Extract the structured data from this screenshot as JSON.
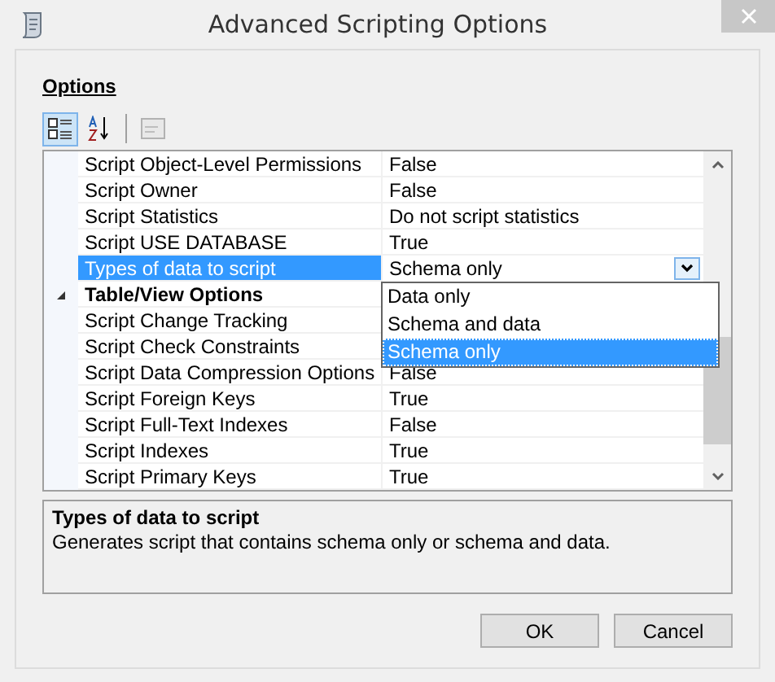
{
  "window": {
    "title": "Advanced Scripting Options"
  },
  "section_label": "Options",
  "toolbar": [
    {
      "kind": "categorized",
      "selected": true
    },
    {
      "kind": "alphabetical",
      "selected": false
    },
    {
      "kind": "pages",
      "selected": false,
      "disabled": true
    }
  ],
  "rows": [
    {
      "kind": "property",
      "name": "Script Object-Level Permissions",
      "value": "False",
      "selected": false
    },
    {
      "kind": "property",
      "name": "Script Owner",
      "value": "False",
      "selected": false
    },
    {
      "kind": "property",
      "name": "Script Statistics",
      "value": "Do not script statistics",
      "selected": false
    },
    {
      "kind": "property",
      "name": "Script USE DATABASE",
      "value": "True",
      "selected": false
    },
    {
      "kind": "dropdown",
      "name": "Types of data to script",
      "value": "Schema only",
      "selected": true
    },
    {
      "kind": "category",
      "name": "Table/View Options",
      "expanded": true
    },
    {
      "kind": "property",
      "name": "Script Change Tracking",
      "selected": false
    },
    {
      "kind": "property",
      "name": "Script Check Constraints",
      "selected": false
    },
    {
      "kind": "property",
      "name": "Script Data Compression Options",
      "value": "False",
      "selected": false
    },
    {
      "kind": "property",
      "name": "Script Foreign Keys",
      "value": "True",
      "selected": false
    },
    {
      "kind": "property",
      "name": "Script Full-Text Indexes",
      "value": "False",
      "selected": false
    },
    {
      "kind": "property",
      "name": "Script Indexes",
      "value": "True",
      "selected": false
    },
    {
      "kind": "property",
      "name": "Script Primary Keys",
      "value": "True",
      "selected": false
    }
  ],
  "dropdown_options": [
    {
      "label": "Data only",
      "selected": false
    },
    {
      "label": "Schema and data",
      "selected": false
    },
    {
      "label": "Schema only",
      "selected": true
    }
  ],
  "description": {
    "title": "Types of data to script",
    "text": "Generates script that contains schema only or schema and data."
  },
  "buttons": [
    "OK",
    "Cancel"
  ]
}
